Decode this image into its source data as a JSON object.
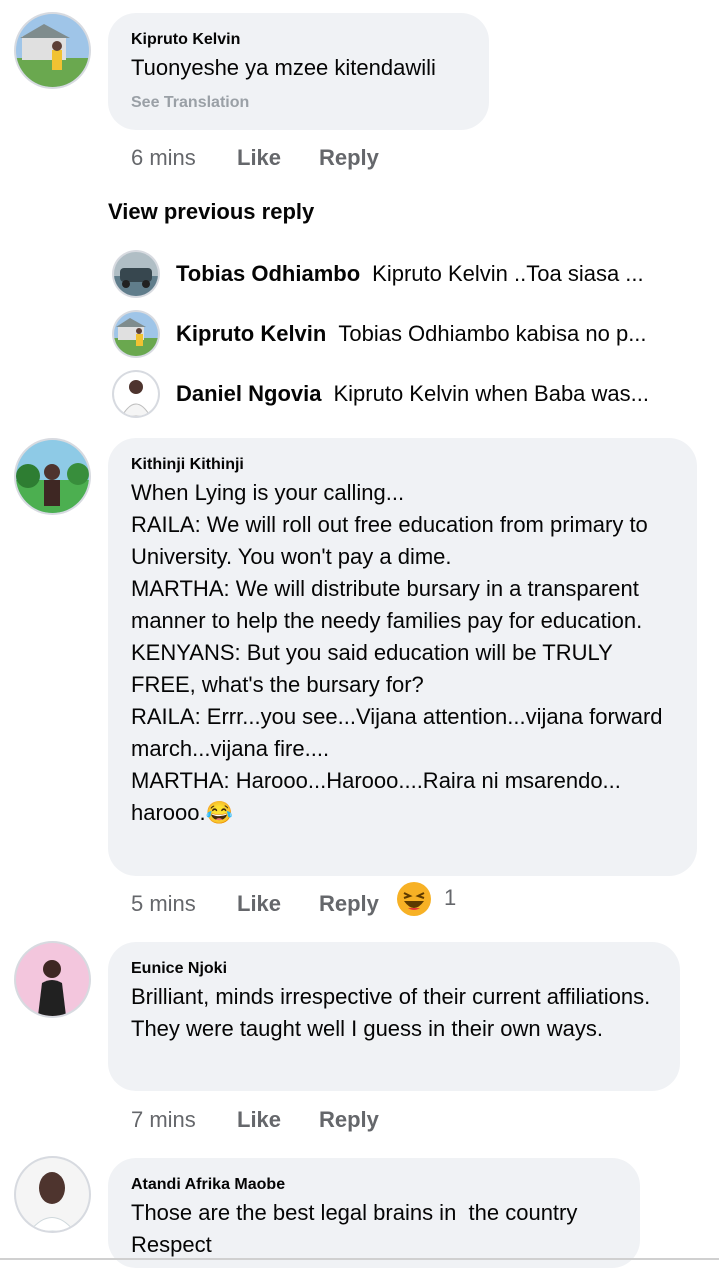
{
  "comments": [
    {
      "author": "Kipruto Kelvin",
      "text": "Tuonyeshe ya mzee kitendawili",
      "see_translation": "See Translation",
      "time": "6 mins",
      "like": "Like",
      "reply": "Reply",
      "view_previous": "View previous reply",
      "replies": [
        {
          "author": "Tobias Odhiambo",
          "text": "Kipruto Kelvin ..Toa siasa ..."
        },
        {
          "author": "Kipruto Kelvin",
          "text": "Tobias Odhiambo kabisa no p..."
        },
        {
          "author": "Daniel Ngovia",
          "text": "Kipruto Kelvin when Baba was..."
        }
      ]
    },
    {
      "author": "Kithinji Kithinji",
      "text": "When Lying is your calling...\nRAILA: We will roll out free education from primary to University. You won't pay a dime.\nMARTHA: We will distribute bursary in a transparent manner to help the needy families pay for education.\nKENYANS: But you said education will be TRULY FREE, what's the bursary for?\nRAILA: Errr...you see...Vijana attention...vijana forward march...vijana fire....\nMARTHA: Harooo...Harooo....Raira ni msarendo... harooo.😂",
      "time": "5 mins",
      "like": "Like",
      "reply": "Reply",
      "reaction_icon": "laughing-emoji-icon",
      "reaction_count": "1"
    },
    {
      "author": "Eunice Njoki",
      "text": "Brilliant, minds irrespective of their current affiliations.  They were taught well I guess in their own ways.",
      "time": "7 mins",
      "like": "Like",
      "reply": "Reply"
    },
    {
      "author": "Atandi Afrika Maobe",
      "text": "Those are the best legal brains in  the country\nRespect"
    }
  ],
  "colors": {
    "bubble": "#f0f2f5",
    "secondary_text": "#65676b",
    "translation": "#9aa0a6",
    "reaction": "#f7b125"
  }
}
